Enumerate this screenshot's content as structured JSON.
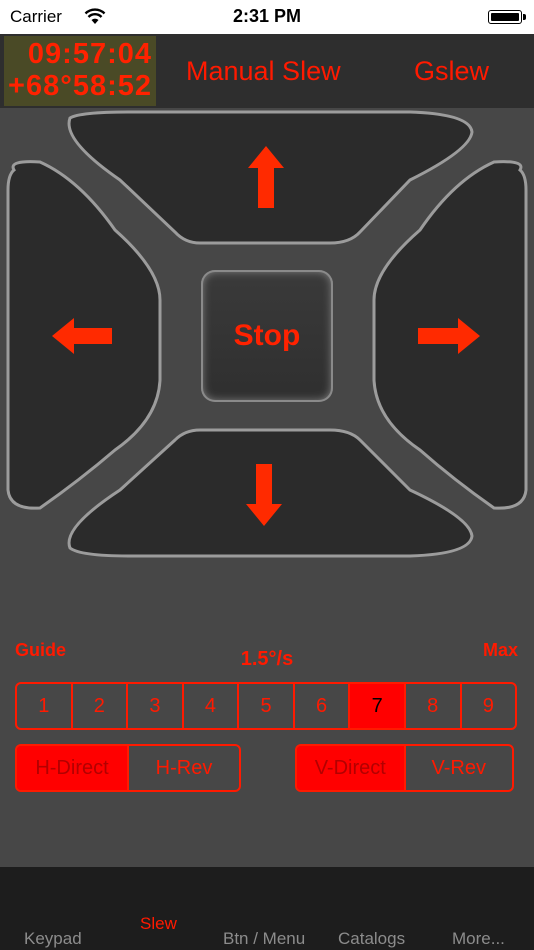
{
  "status_bar": {
    "carrier": "Carrier",
    "time": "2:31 PM"
  },
  "header": {
    "ra": "09:57:04",
    "dec": "+68°58:52",
    "tabs": [
      "Manual Slew",
      "Gslew"
    ]
  },
  "pad": {
    "stop_label": "Stop",
    "directions": [
      "up",
      "down",
      "left",
      "right"
    ]
  },
  "speed": {
    "min_label": "Guide",
    "current": "1.5°/s",
    "max_label": "Max",
    "steps": [
      "1",
      "2",
      "3",
      "4",
      "5",
      "6",
      "7",
      "8",
      "9"
    ],
    "selected": "7"
  },
  "horizontal_direction": {
    "options": [
      "H-Direct",
      "H-Rev"
    ],
    "selected": "H-Direct"
  },
  "vertical_direction": {
    "options": [
      "V-Direct",
      "V-Rev"
    ],
    "selected": "V-Direct"
  },
  "tab_bar": {
    "items": [
      "Keypad",
      "Slew",
      "Btn / Menu",
      "Catalogs",
      "More..."
    ],
    "active": "Slew"
  },
  "colors": {
    "accent": "#ff1a00",
    "background": "#474747",
    "tab_bar": "#1d1d1d"
  }
}
